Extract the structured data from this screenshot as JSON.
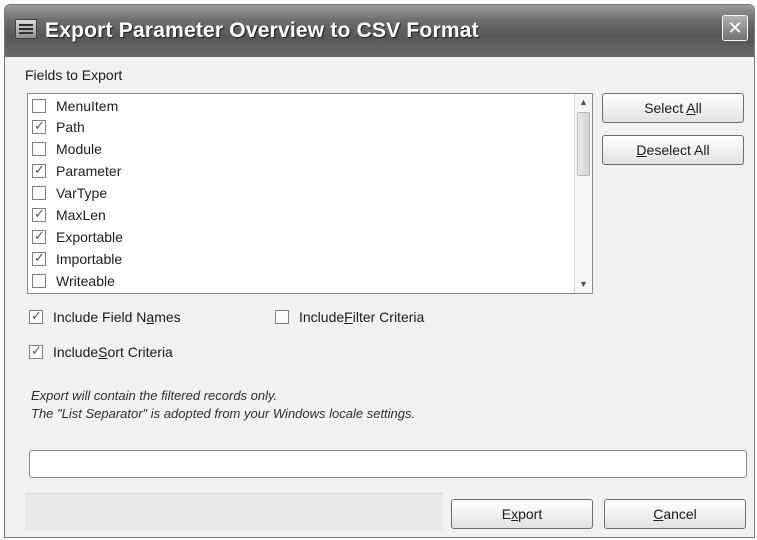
{
  "window": {
    "title": "Export Parameter Overview to CSV Format",
    "close_glyph": "✕"
  },
  "fields": {
    "label": "Fields to Export",
    "items": [
      {
        "label": "MenuItem",
        "checked": false
      },
      {
        "label": "Path",
        "checked": true
      },
      {
        "label": "Module",
        "checked": false
      },
      {
        "label": "Parameter",
        "checked": true
      },
      {
        "label": "VarType",
        "checked": false
      },
      {
        "label": "MaxLen",
        "checked": true
      },
      {
        "label": "Exportable",
        "checked": true
      },
      {
        "label": "Importable",
        "checked": true
      },
      {
        "label": "Writeable",
        "checked": false
      }
    ]
  },
  "buttons": {
    "select_all_pre": "Select ",
    "select_all_mnemonic": "A",
    "select_all_post": "ll",
    "deselect_all_pre": "",
    "deselect_all_mnemonic": "D",
    "deselect_all_post": "eselect All",
    "export_pre": "E",
    "export_mnemonic": "x",
    "export_post": "port",
    "cancel_pre": "",
    "cancel_mnemonic": "C",
    "cancel_post": "ancel"
  },
  "options": {
    "include_field_names": {
      "pre": "Include Field N",
      "mnemonic": "a",
      "post": "mes",
      "checked": true
    },
    "include_filter_criteria": {
      "pre": "Include ",
      "mnemonic": "F",
      "post": "ilter Criteria",
      "checked": false
    },
    "include_sort_criteria": {
      "pre": "Include ",
      "mnemonic": "S",
      "post": "ort Criteria",
      "checked": true
    }
  },
  "info": {
    "line1": "Export will contain the filtered records only.",
    "line2": "The \"List Separator\" is adopted from your Windows locale settings."
  },
  "progress": {
    "value": 0
  },
  "icons": {
    "scroll_up": "▲",
    "scroll_down": "▼"
  }
}
